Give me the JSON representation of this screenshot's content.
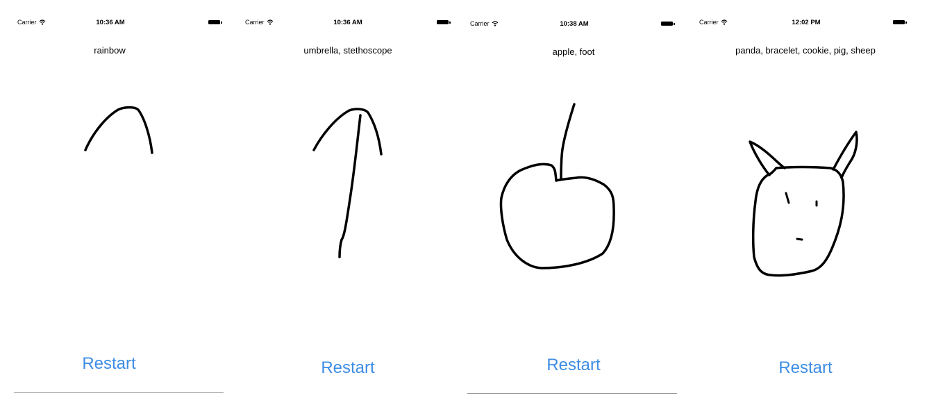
{
  "accent_color": "#3d8de4",
  "stroke_color": "#000000",
  "screens": [
    {
      "carrier": "Carrier",
      "time": "10:36 AM",
      "predictions": "rainbow",
      "restart_label": "Restart",
      "wifi_icon": "wifi-icon",
      "battery_icon": "battery-icon"
    },
    {
      "carrier": "Carrier",
      "time": "10:36 AM",
      "predictions": "umbrella, stethoscope",
      "restart_label": "Restart",
      "wifi_icon": "wifi-icon",
      "battery_icon": "battery-icon"
    },
    {
      "carrier": "Carrier",
      "time": "10:38 AM",
      "predictions": "apple, foot",
      "restart_label": "Restart",
      "wifi_icon": "wifi-icon",
      "battery_icon": "battery-icon"
    },
    {
      "carrier": "Carrier",
      "time": "12:02 PM",
      "predictions": "panda, bracelet, cookie, pig, sheep",
      "restart_label": "Restart",
      "wifi_icon": "wifi-icon",
      "battery_icon": "battery-icon"
    }
  ]
}
